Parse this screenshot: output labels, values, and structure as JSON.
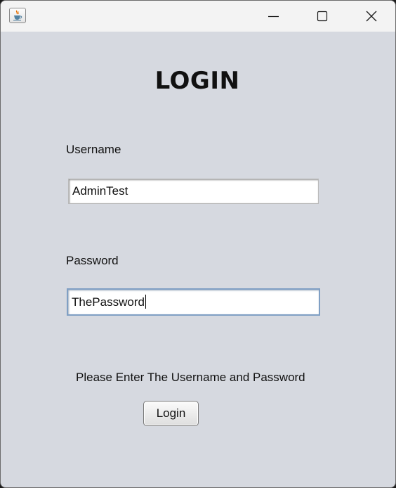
{
  "window": {
    "title_icon": "java-coffee-cup-icon",
    "controls": {
      "minimize_icon": "minimize-icon",
      "maximize_icon": "maximize-icon",
      "close_icon": "close-icon"
    }
  },
  "form": {
    "heading": "LOGIN",
    "username_label": "Username",
    "username_value": "AdminTest",
    "password_label": "Password",
    "password_value": "ThePassword",
    "message": "Please Enter The Username and Password",
    "login_button": "Login"
  },
  "colors": {
    "background": "#d6d9e0",
    "titlebar": "#f3f3f3",
    "focus_border": "#7f9fc4"
  }
}
